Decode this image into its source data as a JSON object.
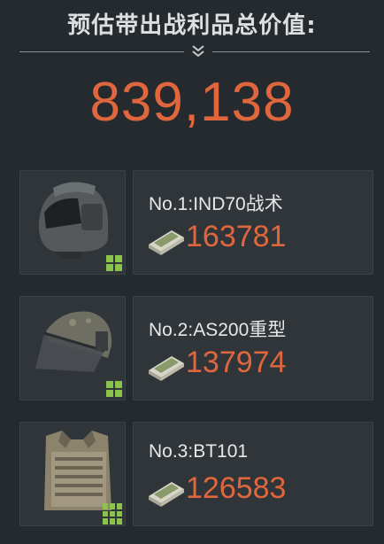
{
  "header": {
    "title": "预估带出战利品总价值:",
    "total_value": "839,138"
  },
  "colors": {
    "background": "#252a2f",
    "panel": "#30353a",
    "accent_orange": "#e0663d",
    "text": "#e6e7e8",
    "grid_green": "#8bc34a"
  },
  "items": [
    {
      "name": "No.1:IND70战术",
      "value": "163781",
      "icon": "helmet-icon"
    },
    {
      "name": "No.2:AS200重型",
      "value": "137974",
      "icon": "heavy-helmet-icon"
    },
    {
      "name": "No.3:BT101",
      "value": "126583",
      "icon": "body-armor-icon"
    }
  ],
  "icons": {
    "currency": "cash-stack-icon",
    "size_indicator": "grid-size-icon",
    "expand": "chevron-double-down-icon"
  }
}
